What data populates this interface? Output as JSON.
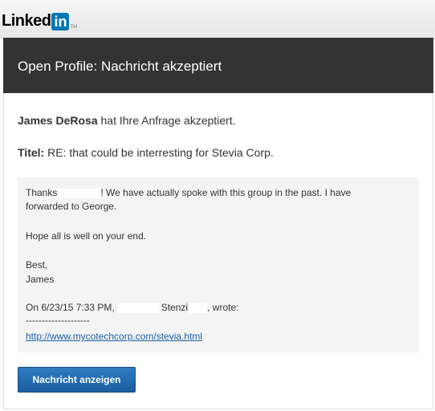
{
  "logo": {
    "text": "Linked",
    "badge": "in",
    "tm": "TM"
  },
  "header": {
    "title": "Open Profile: Nachricht akzeptiert"
  },
  "acceptance": {
    "name": "James DeRosa",
    "text": " hat Ihre Anfrage akzeptiert."
  },
  "subject": {
    "label": "Titel:",
    "value": " RE: that could be interresting for Stevia Corp."
  },
  "message": {
    "line1_a": "Thanks",
    "line1_b": "! We have actually spoke with this group in the past. I have",
    "line2": "forwarded to George.",
    "line3": "Hope all is well on your end.",
    "line4": "Best,",
    "line5": "James",
    "quote_a": "On 6/23/15 7:33 PM,",
    "quote_b": "Stenzi",
    "quote_c": ", wrote:",
    "separator": "--------------------",
    "link": "http://www.mycotechcorp.com/stevia.html"
  },
  "button": {
    "label": "Nachricht anzeigen"
  },
  "colors": {
    "header_bg": "#333333",
    "button_bg": "#2468ae",
    "link": "#1a5fa3",
    "logo_badge": "#0077b5"
  }
}
